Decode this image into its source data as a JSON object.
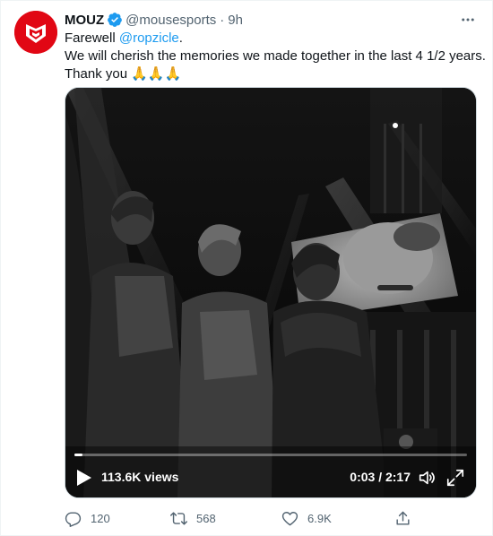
{
  "tweet": {
    "author_name": "MOUZ",
    "handle": "@mousesports",
    "separator": "·",
    "time": "9h",
    "text_line1_prefix": "Farewell ",
    "mention": "@ropzicle",
    "text_line1_suffix": ".",
    "text_line2": "We will cherish the memories we made together in the last 4 1/2 years.",
    "text_line3": "Thank you 🙏🙏🙏"
  },
  "icons": {
    "avatar": "mouz-logo",
    "verified": "verified-badge-icon",
    "more": "more-dots-icon",
    "play": "play-icon",
    "volume": "volume-icon",
    "expand": "fullscreen-icon",
    "reply": "reply-icon",
    "retweet": "retweet-icon",
    "like": "heart-icon",
    "share": "share-icon"
  },
  "video": {
    "views": "113.6K views",
    "timecode": "0:03 / 2:17",
    "progress_fraction": 0.02
  },
  "actions": {
    "reply_count": "120",
    "retweet_count": "568",
    "like_count": "6.9K"
  },
  "colors": {
    "brand_red": "#e10714",
    "link_blue": "#1d9bf0",
    "secondary_text": "#536471"
  }
}
